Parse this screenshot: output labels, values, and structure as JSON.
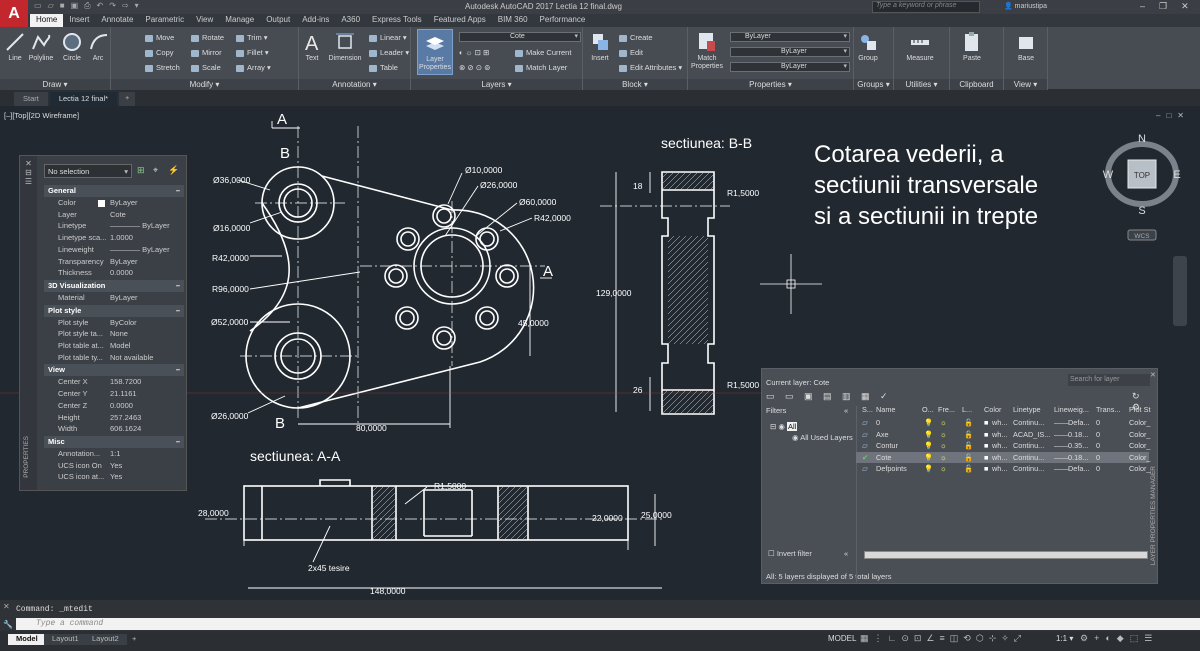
{
  "title_bar": {
    "app_title": "Autodesk AutoCAD 2017    Lectia 12 final.dwg",
    "search_placeholder": "Type a keyword or phrase",
    "user": "mariustipa",
    "logo_letter": "A"
  },
  "ribbon_tabs": [
    "Home",
    "Insert",
    "Annotate",
    "Parametric",
    "View",
    "Manage",
    "Output",
    "Add-ins",
    "A360",
    "Express Tools",
    "Featured Apps",
    "BIM 360",
    "Performance"
  ],
  "draw_panel": {
    "title": "Draw ▾",
    "buttons": [
      "Line",
      "Polyline",
      "Circle",
      "Arc"
    ]
  },
  "modify_panel": {
    "title": "Modify ▾",
    "buttons": [
      "Move",
      "Rotate",
      "Trim ▾",
      "Copy",
      "Mirror",
      "Fillet ▾",
      "Stretch",
      "Scale",
      "Array ▾"
    ]
  },
  "annotation_panel": {
    "title": "Annotation ▾",
    "text": "Text",
    "dimension": "Dimension",
    "linear": "Linear ▾",
    "leader": "Leader ▾",
    "table": "Table"
  },
  "layers_panel": {
    "title": "Layers ▾",
    "layer_properties": "Layer Properties",
    "current_layer": "Cote",
    "make_current": "Make Current",
    "match_layer": "Match Layer"
  },
  "block_panel": {
    "title": "Block ▾",
    "insert": "Insert",
    "create": "Create",
    "edit": "Edit",
    "edit_attributes": "Edit Attributes ▾"
  },
  "properties_panel": {
    "title": "Properties ▾",
    "match": "Match Properties",
    "color": "ByLayer",
    "linetype": "ByLayer",
    "lineweight": "ByLayer"
  },
  "groups_panel": {
    "title": "Groups ▾",
    "group": "Group"
  },
  "utilities_panel": {
    "title": "Utilities ▾",
    "measure": "Measure"
  },
  "clipboard_panel": {
    "title": "Clipboard",
    "paste": "Paste"
  },
  "view_panel": {
    "title": "View ▾",
    "base": "Base"
  },
  "file_tabs": [
    "Start",
    "Lectia 12 final*"
  ],
  "viewport_label": "[–][Top][2D Wireframe]",
  "drawing": {
    "note": [
      "Cotarea vederii, a",
      "sectiunii transversale",
      "si a sectiunii in trepte"
    ],
    "section_bb": "sectiunea: B-B",
    "section_aa": "sectiunea: A-A",
    "labels": {
      "A": "A",
      "B": "B"
    },
    "dims": [
      "Ø36,0000",
      "Ø16,0000",
      "R42,0000",
      "R96,0000",
      "Ø52,0000",
      "Ø26,0000",
      "Ø10,0000",
      "Ø26,0000",
      "Ø60,0000",
      "R42,0000",
      "45,0000",
      "80,0000",
      "R1,5000",
      "18",
      "129,0000",
      "26",
      "R1,5000",
      "R1,5000",
      "28,0000",
      "22,0000",
      "25,0000",
      "2x45 tesire",
      "148,0000"
    ]
  },
  "viewcube": {
    "top": "TOP",
    "n": "N",
    "s": "S",
    "e": "E",
    "w": "W",
    "wcs": "WCS"
  },
  "properties_palette": {
    "selection": "No selection",
    "side_label": "PROPERTIES",
    "sections": [
      {
        "name": "General",
        "rows": [
          [
            "Color",
            "ByLayer"
          ],
          [
            "Layer",
            "Cote"
          ],
          [
            "Linetype",
            "———— ByLayer"
          ],
          [
            "Linetype sca...",
            "1.0000"
          ],
          [
            "Lineweight",
            "———— ByLayer"
          ],
          [
            "Transparency",
            "ByLayer"
          ],
          [
            "Thickness",
            "0.0000"
          ]
        ]
      },
      {
        "name": "3D Visualization",
        "rows": [
          [
            "Material",
            "ByLayer"
          ]
        ]
      },
      {
        "name": "Plot style",
        "rows": [
          [
            "Plot style",
            "ByColor"
          ],
          [
            "Plot style ta...",
            "None"
          ],
          [
            "Plot table at...",
            "Model"
          ],
          [
            "Plot table ty...",
            "Not available"
          ]
        ]
      },
      {
        "name": "View",
        "rows": [
          [
            "Center X",
            "158.7200"
          ],
          [
            "Center Y",
            "21.1161"
          ],
          [
            "Center Z",
            "0.0000"
          ],
          [
            "Height",
            "257.2463"
          ],
          [
            "Width",
            "606.1624"
          ]
        ]
      },
      {
        "name": "Misc",
        "rows": [
          [
            "Annotation...",
            "1:1"
          ],
          [
            "UCS icon On",
            "Yes"
          ],
          [
            "UCS icon at...",
            "Yes"
          ]
        ]
      }
    ]
  },
  "layer_manager": {
    "current_layer": "Current layer: Cote",
    "search_placeholder": "Search for layer",
    "filters_label": "Filters",
    "tree": [
      "All",
      "All Used Layers"
    ],
    "columns": [
      "S...",
      "Name",
      "O...",
      "Fre...",
      "L...",
      "Color",
      "Linetype",
      "Lineweig...",
      "Trans...",
      "Plot St"
    ],
    "rows": [
      {
        "name": "0",
        "color": "wh...",
        "linetype": "Continu...",
        "lineweight": "Defa...",
        "trans": "0",
        "plot": "Color_",
        "current": false
      },
      {
        "name": "Axe",
        "color": "wh...",
        "linetype": "ACAD_IS...",
        "lineweight": "0.18...",
        "trans": "0",
        "plot": "Color_",
        "current": false
      },
      {
        "name": "Contur",
        "color": "wh...",
        "linetype": "Continu...",
        "lineweight": "0.35...",
        "trans": "0",
        "plot": "Color_",
        "current": false
      },
      {
        "name": "Cote",
        "color": "wh...",
        "linetype": "Continu...",
        "lineweight": "0.18...",
        "trans": "0",
        "plot": "Color_",
        "current": true
      },
      {
        "name": "Defpoints",
        "color": "wh...",
        "linetype": "Continu...",
        "lineweight": "Defa...",
        "trans": "0",
        "plot": "Color_",
        "current": false
      }
    ],
    "invert_filter": "Invert filter",
    "status": "All: 5 layers displayed of 5 total layers",
    "side_label": "LAYER PROPERTIES MANAGER"
  },
  "command": {
    "history": "Command: _mtedit",
    "placeholder": "Type a command"
  },
  "status_bar": {
    "layouts": [
      "Model",
      "Layout1",
      "Layout2"
    ],
    "model": "MODEL",
    "scale": "1:1 ▾"
  }
}
